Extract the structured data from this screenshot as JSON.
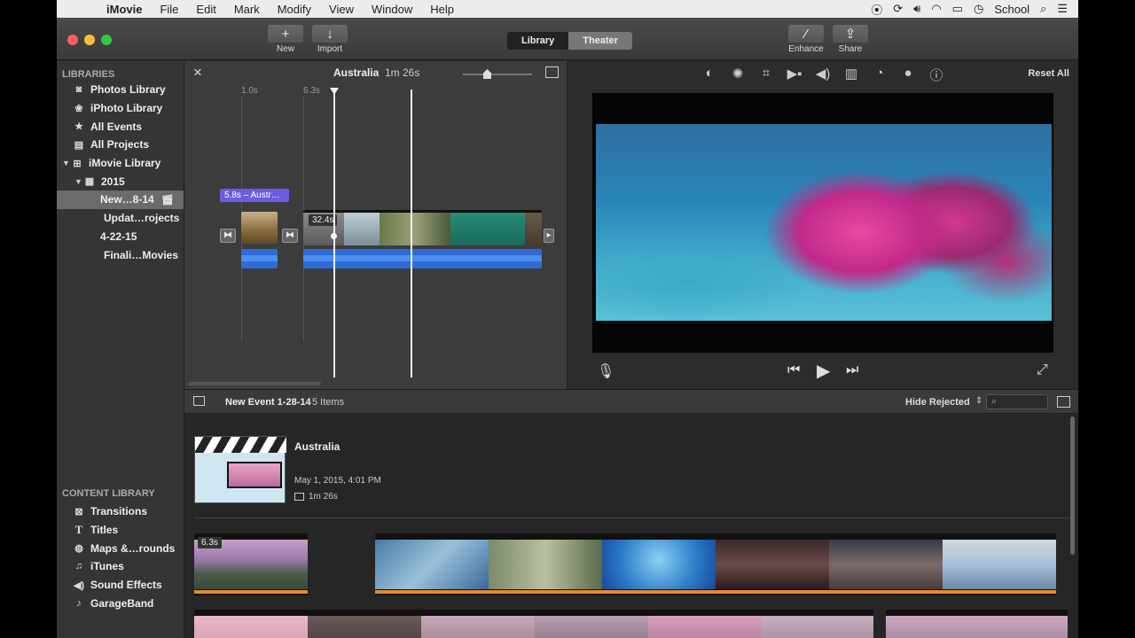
{
  "menubar": {
    "app": "iMovie",
    "items": [
      "File",
      "Edit",
      "Mark",
      "Modify",
      "View",
      "Window",
      "Help"
    ],
    "user": "School"
  },
  "toolbar": {
    "new_label": "New",
    "import_label": "Import",
    "library_label": "Library",
    "theater_label": "Theater",
    "enhance_label": "Enhance",
    "share_label": "Share"
  },
  "sidebar": {
    "libraries_heading": "LIBRARIES",
    "items": [
      {
        "label": "Photos Library",
        "icon": "camera-icon"
      },
      {
        "label": "iPhoto Library",
        "icon": "iphoto-icon"
      },
      {
        "label": "All Events",
        "icon": "star-icon"
      },
      {
        "label": "All Projects",
        "icon": "projects-icon"
      },
      {
        "label": "iMovie Library",
        "icon": "grid-icon"
      },
      {
        "label": "2015",
        "icon": "calendar-icon"
      },
      {
        "label": "New…8-14",
        "icon": "clapper-icon"
      },
      {
        "label": "Updat…rojects"
      },
      {
        "label": "4-22-15"
      },
      {
        "label": "Finali…Movies"
      }
    ],
    "content_heading": "CONTENT LIBRARY",
    "content_items": [
      {
        "label": "Transitions",
        "icon": "transitions-icon"
      },
      {
        "label": "Titles",
        "icon": "titles-icon"
      },
      {
        "label": "Maps &…rounds",
        "icon": "globe-icon"
      },
      {
        "label": "iTunes",
        "icon": "music-icon"
      },
      {
        "label": "Sound Effects",
        "icon": "speaker-icon"
      },
      {
        "label": "GarageBand",
        "icon": "guitar-icon"
      }
    ]
  },
  "timeline": {
    "title": "Australia",
    "duration": "1m 26s",
    "tick_1": "1.0s",
    "tick_2": "6.3s",
    "clip_tag": "5.8s – Austr…",
    "clip_badge": "32.4s"
  },
  "viewer": {
    "reset_label": "Reset All"
  },
  "browser_bar": {
    "event_name": "New Event 1-28-14",
    "count": "5 Items",
    "filter": "Hide Rejected"
  },
  "browser": {
    "project_name": "Australia",
    "project_date": "May 1, 2015, 4:01 PM",
    "project_duration": "1m 26s",
    "clip_badge": "6.3s"
  },
  "colors": {
    "accent_purple": "#6b5de0",
    "audio_blue": "#2f6bd6",
    "clip_orange": "#e68a2e"
  }
}
